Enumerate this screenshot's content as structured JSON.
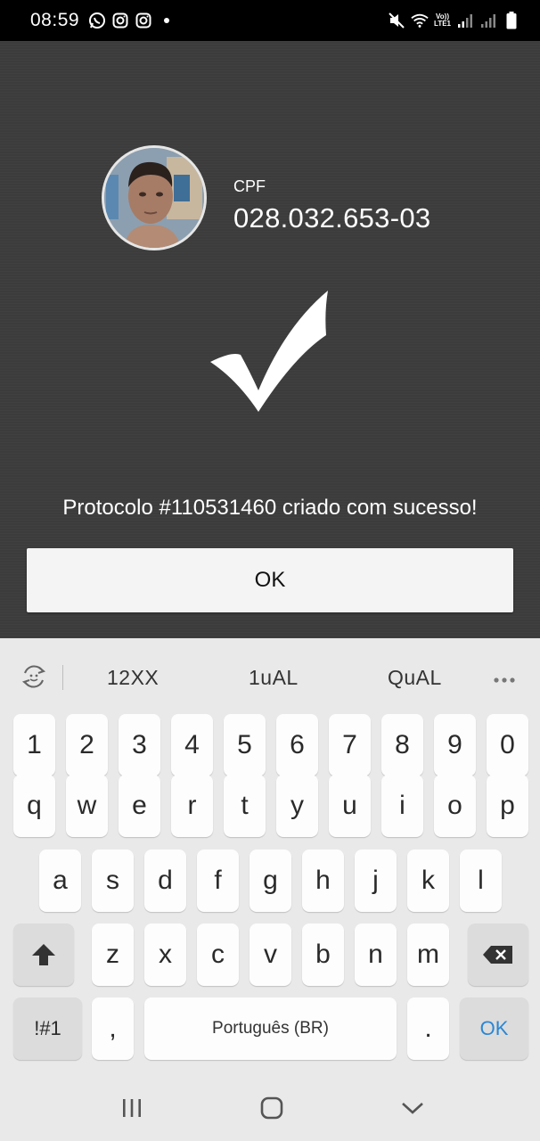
{
  "status_bar": {
    "time": "08:59",
    "network_label": "LTE1",
    "volte_label": "Vo))"
  },
  "profile": {
    "cpf_label": "CPF",
    "cpf_value": "028.032.653-03"
  },
  "message": {
    "text": "Protocolo #110531460 criado com sucesso!"
  },
  "dialog": {
    "ok_label": "OK"
  },
  "keyboard": {
    "suggestions": [
      "12XX",
      "1uAL",
      "QuAL"
    ],
    "row_numbers": [
      "1",
      "2",
      "3",
      "4",
      "5",
      "6",
      "7",
      "8",
      "9",
      "0"
    ],
    "row_1": [
      "q",
      "w",
      "e",
      "r",
      "t",
      "y",
      "u",
      "i",
      "o",
      "p"
    ],
    "row_2": [
      "a",
      "s",
      "d",
      "f",
      "g",
      "h",
      "j",
      "k",
      "l"
    ],
    "row_3": [
      "z",
      "x",
      "c",
      "v",
      "b",
      "n",
      "m"
    ],
    "symbols_label": "!#1",
    "comma_label": ",",
    "space_label": "Português (BR)",
    "period_label": ".",
    "ok_label": "OK"
  },
  "colors": {
    "panel_bg": "#3c3c3c",
    "keyboard_bg": "#e9e9e9",
    "ok_key_accent": "#2b86d4"
  }
}
